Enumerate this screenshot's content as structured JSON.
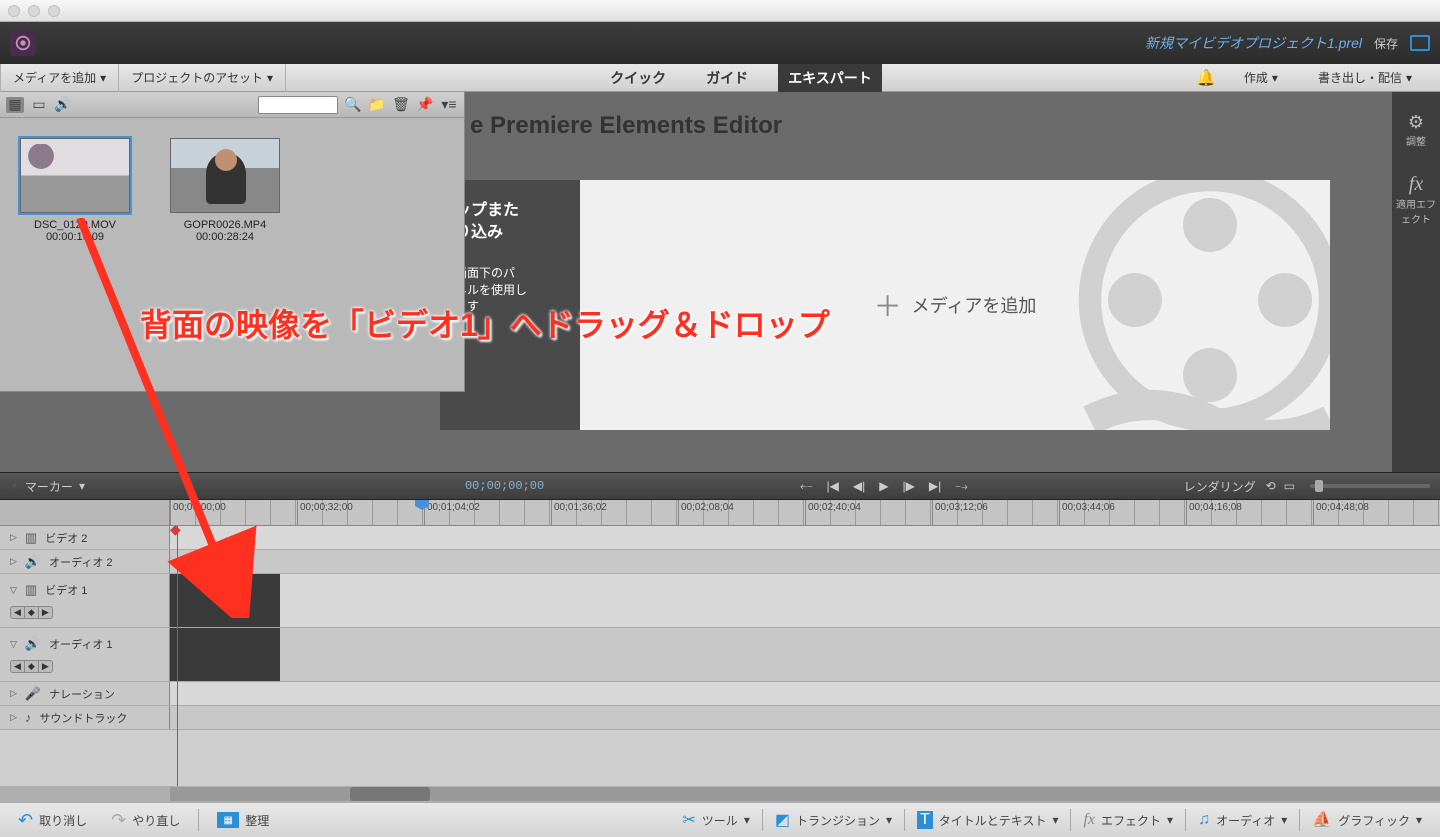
{
  "titlebar": {},
  "header": {
    "project_name": "新規マイビデオプロジェクト1.prel",
    "save": "保存"
  },
  "menubar": {
    "add_media": "メディアを追加",
    "dropdown_arrow": "▾",
    "project_assets": "プロジェクトのアセット",
    "modes": {
      "quick": "クイック",
      "guide": "ガイド",
      "expert": "エキスパート"
    },
    "create": "作成",
    "export": "書き出し・配信"
  },
  "assets": {
    "items": [
      {
        "name": "DSC_0129.MOV",
        "duration": "00:00:16:09"
      },
      {
        "name": "GOPR0026.MP4",
        "duration": "00:00:28:24"
      }
    ]
  },
  "monitor": {
    "title": "e Premiere Elements Editor",
    "drop_hint_l1": "ップまた",
    "drop_hint_l2": "り込み",
    "drop_hint_l3": "画面下のパ",
    "drop_hint_l4": "ネルを使用し",
    "drop_hint_l5": "ます",
    "add_media_plus": "＋",
    "add_media_label": "メディアを追加"
  },
  "right_sidebar": {
    "adjust": "調整",
    "fx": "fx",
    "effects": "適用エフェクト"
  },
  "annotation": "背面の映像を「ビデオ1」へドラッグ＆ドロップ",
  "playback": {
    "marker": "マーカー",
    "dropdown": "▾",
    "timecode": "00;00;00;00",
    "render": "レンダリング"
  },
  "ruler": {
    "ticks": [
      "00;00;00;00",
      "00;00;32;00",
      "00;01;04;02",
      "00;01;36;02",
      "00;02;08;04",
      "00;02;40;04",
      "00;03;12;06",
      "00;03;44;06",
      "00;04;16;08",
      "00;04;48;08"
    ]
  },
  "tracks": {
    "video2": "ビデオ 2",
    "audio2": "オーディオ 2",
    "video1": "ビデオ 1",
    "audio1": "オーディオ 1",
    "narration": "ナレーション",
    "soundtrack": "サウンドトラック"
  },
  "bottombar": {
    "undo": "取り消し",
    "redo": "やり直し",
    "organize": "整理",
    "tools": "ツール",
    "transition": "トランジション",
    "titles": "タイトルとテキスト",
    "effects": "エフェクト",
    "audio": "オーディオ",
    "graphics": "グラフィック"
  }
}
